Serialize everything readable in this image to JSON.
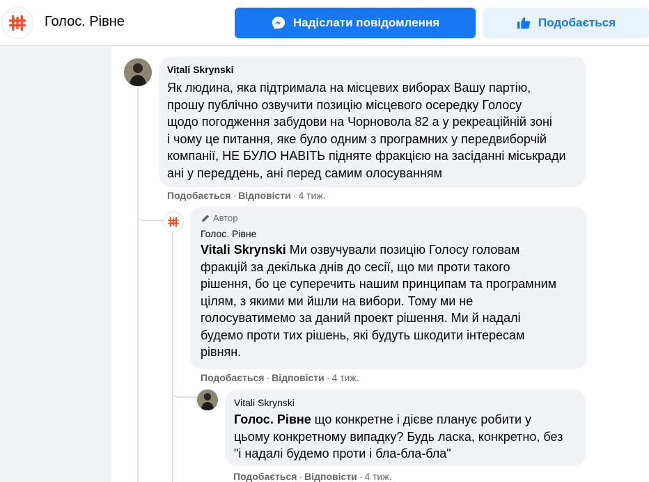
{
  "header": {
    "page_name": "Голос. Рівне",
    "message_button": "Надіслати повідомлення",
    "like_button": "Подобається",
    "brand_color": "#1877f2",
    "logo_color": "#f0512b"
  },
  "comments": [
    {
      "author": "Vitali Skrynski",
      "lines": [
        "Як людина, яка підтримала на місцевих виборах Вашу партію,",
        "прошу публічно озвучити позицію місцевого осередку Голосу",
        "щодо погодження забудови на Чорновола 82 а у рекреаційній зоні",
        "і чому це питання, яке було одним з програмних у передвиборчій",
        "компанії, НЕ БУЛО НАВІТЬ підняте фракцією на засіданні міськради",
        "ані у переддень, ані перед самим олосуванням"
      ],
      "like": "Подобається",
      "reply": "Відповісти",
      "time": "4 тиж."
    },
    {
      "badge": "Автор",
      "author": "Голос. Рівне",
      "mention": "Vitali Skrynski",
      "lines": [
        " Ми озвучували позицію Голосу головам",
        "фракцій за декілька днів до сесії, що ми проти такого",
        "рішення, бо це суперечить нашим принципам та програмним",
        "цілям, з якими ми йшли на вибори. Тому ми не",
        "голосуватимемо за даний проект рішення. Ми й надалі",
        "будемо проти тих рішень, які будуть шкодити інтересам",
        "рівнян."
      ],
      "like": "Подобається",
      "reply": "Відповісти",
      "time": "4 тиж."
    },
    {
      "author": "Vitali Skrynski",
      "mention": "Голос. Рівне",
      "lines": [
        " що конкретне і дієве планує робити у",
        "цьому конкретному випадку? Будь ласка, конкретно, без",
        "\"і надалі будемо проти і бла-бла-бла\""
      ],
      "like": "Подобається",
      "reply": "Відповісти",
      "time": "4 тиж."
    }
  ],
  "separator": "·"
}
